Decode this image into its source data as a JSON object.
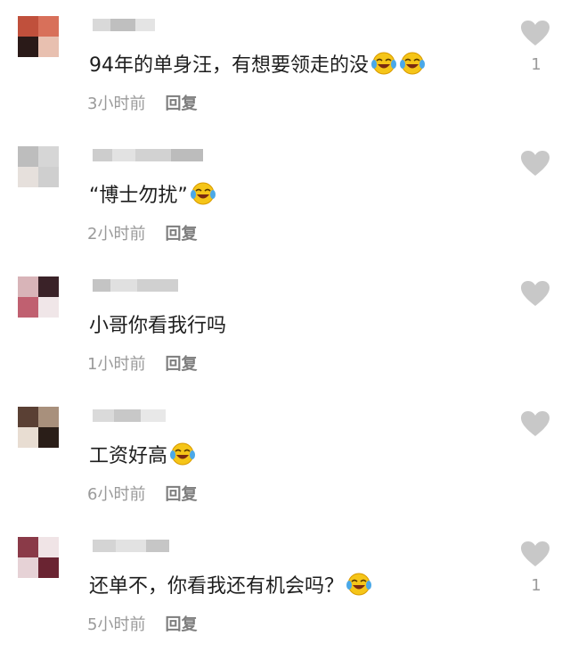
{
  "comments": [
    {
      "text": "94年的单身汪，有想要领走的没",
      "time": "3小时前",
      "reply": "回复",
      "likes": "1",
      "emoji_count": 2
    },
    {
      "text": "“博士勿扰”",
      "time": "2小时前",
      "reply": "回复",
      "likes": "",
      "emoji_count": 1
    },
    {
      "text": "小哥你看我行吗",
      "time": "1小时前",
      "reply": "回复",
      "likes": "",
      "emoji_count": 0
    },
    {
      "text": "工资好高",
      "time": "6小时前",
      "reply": "回复",
      "likes": "",
      "emoji_count": 1
    },
    {
      "text": "还单不，你看我还有机会吗？",
      "time": "5小时前",
      "reply": "回复",
      "likes": "1",
      "emoji_count": 1
    }
  ],
  "icons": {
    "like": "heart-icon",
    "emoji": "laughing-crying-emoji-icon"
  },
  "colors": {
    "heart": "#c8c8c8",
    "text": "#1e1e1e",
    "meta": "#9a9a9a"
  }
}
